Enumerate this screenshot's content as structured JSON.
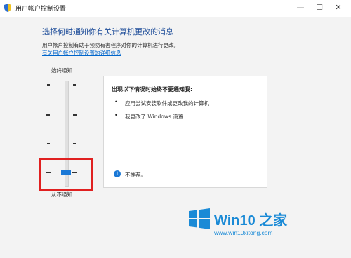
{
  "window": {
    "title": "用户帐户控制设置",
    "minimize_glyph": "—",
    "maximize_glyph": "☐",
    "close_glyph": "✕"
  },
  "heading": "选择何时通知你有关计算机更改的消息",
  "description": "用户帐户控制有助于预防有害程序对你的计算机进行更改。",
  "link": "有关用户帐户控制设置的详细信息",
  "slider": {
    "top_label": "始终通知",
    "bottom_label": "从不通知",
    "selected_level": 0,
    "levels": 4
  },
  "panel": {
    "title": "出现以下情况时始终不要通知我:",
    "bullets": [
      "应用尝试安装软件或更改我的计算机",
      "我更改了 Windows 设置"
    ],
    "info_icon_glyph": "i",
    "info_text": "不推荐。"
  },
  "watermark": {
    "brand": "Win10 之家",
    "url": "www.win10xitong.com",
    "logo_icon": "windows-logo-icon"
  },
  "colors": {
    "accent": "#1a78d6",
    "heading": "#1f4e9a",
    "highlight_box": "#e02020"
  }
}
